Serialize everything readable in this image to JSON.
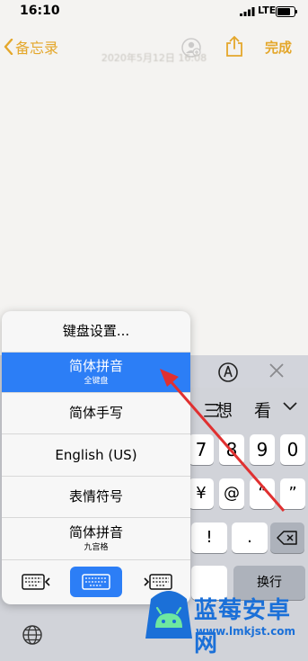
{
  "status_bar": {
    "time": "16:10",
    "network": "LTE"
  },
  "nav": {
    "back_label": "备忘录",
    "done_label": "完成",
    "date_text": "2020年5月12日 16:08"
  },
  "candidates": [
    "三",
    "想",
    "看"
  ],
  "keyboard": {
    "row1": [
      "7",
      "8",
      "9",
      "0"
    ],
    "row2": [
      "¥",
      "@",
      "“",
      "”"
    ],
    "row3": [
      "!",
      "."
    ],
    "return_label": "换行"
  },
  "input_menu": {
    "items": [
      {
        "label": "键盘设置...",
        "sub": ""
      },
      {
        "label": "简体拼音",
        "sub": "全键盘",
        "selected": true
      },
      {
        "label": "简体手写",
        "sub": ""
      },
      {
        "label": "English (US)",
        "sub": ""
      },
      {
        "label": "表情符号",
        "sub": ""
      },
      {
        "label": "简体拼音",
        "sub": "九宫格"
      }
    ]
  },
  "watermark": {
    "title": "蓝莓安卓网",
    "url": "www.lmkjst.com"
  },
  "colors": {
    "accent": "#e4a72b",
    "selection": "#2c7ef6",
    "arrow": "#e03030",
    "brand": "#1b70d8"
  }
}
